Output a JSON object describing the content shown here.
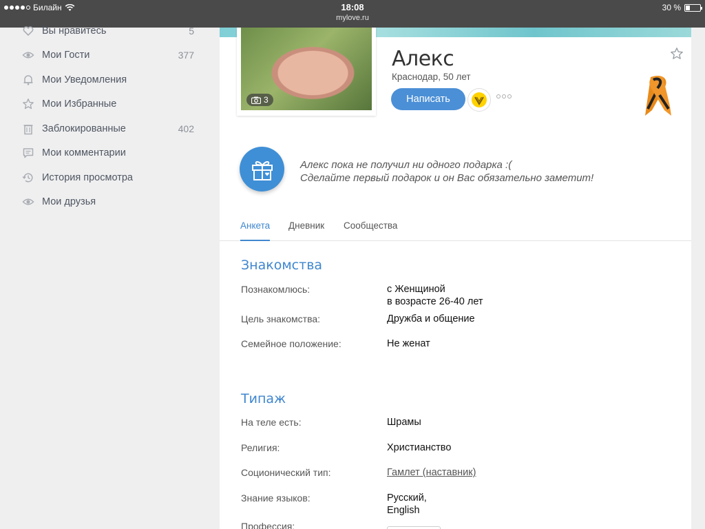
{
  "statusbar": {
    "carrier": "Билайн",
    "time": "18:08",
    "url": "mylove.ru",
    "battery_text": "30 %",
    "battery_level": 0.3
  },
  "sidebar": {
    "items": [
      {
        "label": "Вы нравитесь",
        "count": "5",
        "icon": "heart-icon"
      },
      {
        "label": "Мои Гости",
        "count": "377",
        "icon": "eye-icon"
      },
      {
        "label": "Мои Уведомления",
        "count": "",
        "icon": "bell-icon"
      },
      {
        "label": "Мои Избранные",
        "count": "",
        "icon": "star-icon"
      },
      {
        "label": "Заблокированные",
        "count": "402",
        "icon": "trash-icon"
      },
      {
        "label": "Мои комментарии",
        "count": "",
        "icon": "comment-icon"
      },
      {
        "label": "История просмотра",
        "count": "",
        "icon": "history-icon"
      },
      {
        "label": "Мои друзья",
        "count": "",
        "icon": "eye-icon"
      }
    ]
  },
  "profile": {
    "name": "Алекс",
    "location_age": "Краснодар, 50 лет",
    "photo_count": "3",
    "write_button": "Написать"
  },
  "gifts": {
    "line1": "Алекс пока не получил ни одного подарка :(",
    "line2": "Сделайте первый подарок и он Вас обязательно заметит!"
  },
  "tabs": [
    {
      "label": "Анкета",
      "active": true
    },
    {
      "label": "Дневник",
      "active": false
    },
    {
      "label": "Сообщества",
      "active": false
    }
  ],
  "sections": {
    "acquaintance": {
      "title": "Знакомства",
      "rows": [
        {
          "label": "Познакомлюсь:",
          "value_line1": "с Женщиной",
          "value_line2": "в возрасте 26-40 лет"
        },
        {
          "label": "Цель знакомства:",
          "value_line1": "Дружба и общение"
        },
        {
          "label": "Семейное положение:",
          "value_line1": "Не женат"
        }
      ]
    },
    "type": {
      "title": "Типаж",
      "rows": [
        {
          "label": "На теле есть:",
          "value_line1": "Шрамы"
        },
        {
          "label": "Религия:",
          "value_line1": "Христианство"
        },
        {
          "label": "Соционический тип:",
          "value_line1": "Гамлет (наставник)"
        },
        {
          "label": "Знание языков:",
          "value_line1": "Русский,",
          "value_line2": "English"
        },
        {
          "label": "Профессия:"
        }
      ]
    }
  },
  "colors": {
    "accent": "#3f86cf",
    "button": "#4b8fd6",
    "statusbar": "#4a4a4a"
  }
}
